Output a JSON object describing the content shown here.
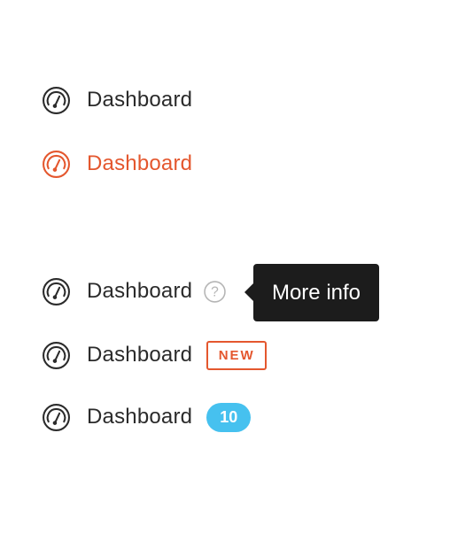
{
  "nav_items": [
    {
      "label": "Dashboard",
      "icon": "dashboard-gauge-icon",
      "state": "default"
    },
    {
      "label": "Dashboard",
      "icon": "dashboard-gauge-icon",
      "state": "active"
    },
    {
      "label": "Dashboard",
      "icon": "dashboard-gauge-icon",
      "state": "default",
      "help_icon": "question-circle-icon",
      "tooltip": "More info"
    },
    {
      "label": "Dashboard",
      "icon": "dashboard-gauge-icon",
      "state": "default",
      "badge": "NEW"
    },
    {
      "label": "Dashboard",
      "icon": "dashboard-gauge-icon",
      "state": "default",
      "count": "10"
    }
  ],
  "colors": {
    "text": "#2b2b2b",
    "accent": "#e4572e",
    "tooltip_bg": "#1c1c1c",
    "count_badge_bg": "#46c1ef",
    "help_icon": "#b5b5b5"
  }
}
